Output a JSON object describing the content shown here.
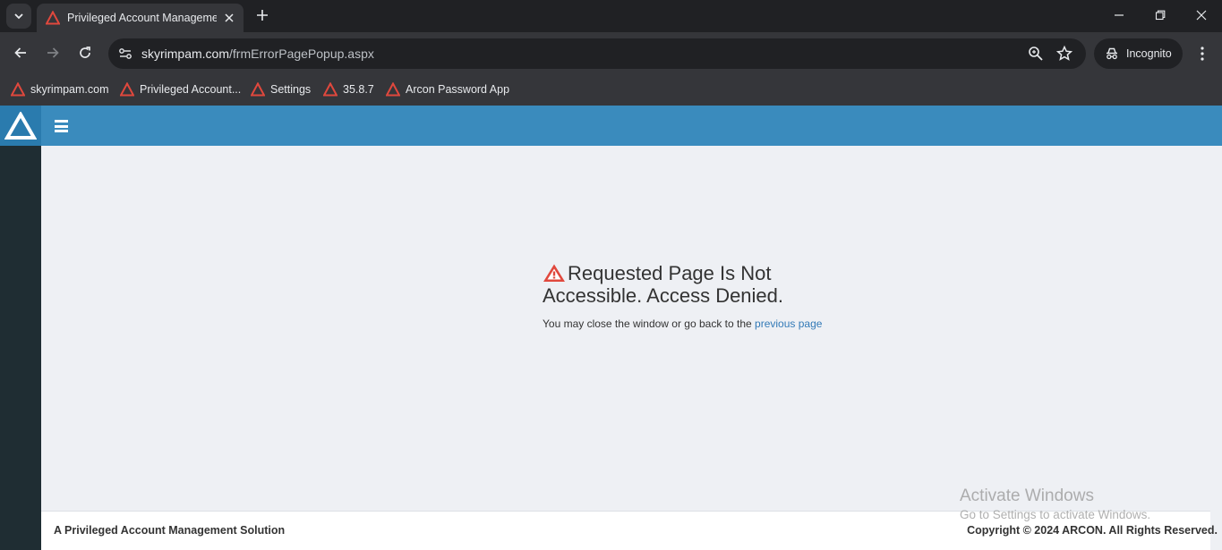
{
  "browser": {
    "tab": {
      "title": "Privileged Account Management"
    },
    "address": {
      "domain": "skyrimpam.com",
      "path": "/frmErrorPagePopup.aspx"
    },
    "incognito_label": "Incognito",
    "bookmarks": [
      {
        "label": "skyrimpam.com"
      },
      {
        "label": "Privileged Account..."
      },
      {
        "label": "Settings"
      },
      {
        "label": "35.8.7"
      },
      {
        "label": "Arcon Password App"
      }
    ]
  },
  "error": {
    "title": "Requested Page Is Not Accessible. Access Denied.",
    "message_prefix": "You may close the window or go back to the ",
    "link_text": "previous page"
  },
  "footer": {
    "left": "A Privileged Account Management Solution",
    "right": "Copyright © 2024 ARCON. All Rights Reserved."
  },
  "watermark": {
    "line1": "Activate Windows",
    "line2": "Go to Settings to activate Windows."
  },
  "colors": {
    "header": "#3a8bbd",
    "sidebar": "#1f2d33",
    "content_bg": "#eef0f4",
    "warning_red": "#e0483d",
    "link": "#337ab7"
  }
}
